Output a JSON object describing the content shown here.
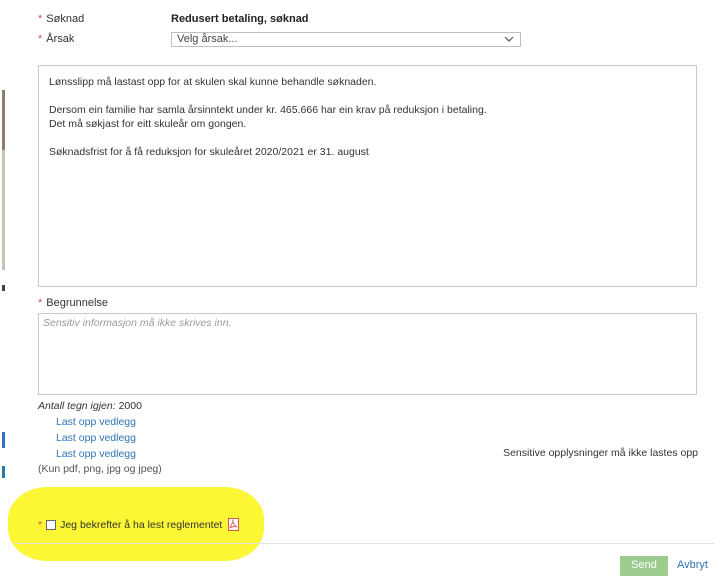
{
  "form": {
    "soknad_label": "Søknad",
    "soknad_value": "Redusert betaling, søknad",
    "arsak_label": "Årsak",
    "arsak_select_value": "Velg årsak...",
    "info_lines": [
      "Lønsslipp må lastast opp for at skulen skal kunne behandle søknaden.",
      "Dersom ein familie har samla årsinntekt under kr. 465.666 har ein krav på reduksjon i betaling.",
      "Det må søkjast for eitt skuleår om gongen.",
      "Søknadsfrist for å få reduksjon for skuleåret 2020/2021 er 31. august"
    ],
    "begrunnelse_label": "Begrunnelse",
    "begrunnelse_placeholder": "Sensitiv informasjon må ikke skrives inn.",
    "counter_label": "Antall tegn igjen:",
    "counter_value": "2000",
    "upload_links": [
      "Last opp vedlegg",
      "Last opp vedlegg",
      "Last opp vedlegg"
    ],
    "sensitive_note": "Sensitive opplysninger må ikke lastes opp",
    "file_types": "(Kun pdf, png, jpg og jpeg)",
    "confirm_label": "Jeg bekrefter å ha lest reglementet",
    "required_marker": "*"
  },
  "actions": {
    "send_label": "Send",
    "cancel_label": "Avbryt"
  },
  "colors": {
    "highlight": "#fbf734",
    "link": "#2f74b5",
    "send_button": "#9ccc8e",
    "required": "#d9534f"
  }
}
